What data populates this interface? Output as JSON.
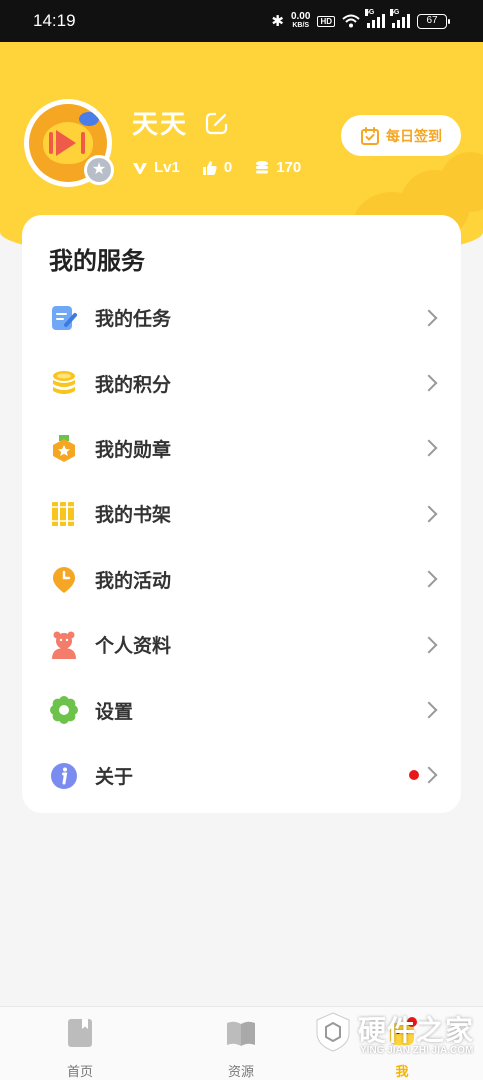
{
  "status_bar": {
    "time": "14:19",
    "net_speed_value": "0.00",
    "net_speed_unit": "KB/S",
    "hd_label": "HD",
    "signal_1": "5G",
    "signal_2": "5G",
    "battery": "67"
  },
  "profile": {
    "username": "天天",
    "level": "Lv1",
    "likes": "0",
    "points": "170",
    "checkin_label": "每日签到"
  },
  "services": {
    "title": "我的服务",
    "items": [
      {
        "label": "我的任务",
        "icon": "task-icon"
      },
      {
        "label": "我的积分",
        "icon": "coins-icon"
      },
      {
        "label": "我的勋章",
        "icon": "medal-icon"
      },
      {
        "label": "我的书架",
        "icon": "bookshelf-icon"
      },
      {
        "label": "我的活动",
        "icon": "activity-icon"
      },
      {
        "label": "个人资料",
        "icon": "profile-icon"
      },
      {
        "label": "设置",
        "icon": "settings-icon"
      },
      {
        "label": "关于",
        "icon": "info-icon",
        "has_dot": true
      }
    ]
  },
  "bottom_nav": {
    "items": [
      {
        "label": "首页",
        "icon": "home-book-icon"
      },
      {
        "label": "资源",
        "icon": "resource-book-icon"
      },
      {
        "label": "我",
        "icon": "me-icon",
        "active": true,
        "notification": true
      }
    ]
  },
  "watermark": {
    "brand": "硬件之家",
    "sub": "YING JIAN ZHI JIA.COM"
  },
  "colors": {
    "header_yellow": "#ffd43b",
    "accent_orange": "#f5a623",
    "active_nav": "#f5b400",
    "notify_red": "#e81818"
  }
}
